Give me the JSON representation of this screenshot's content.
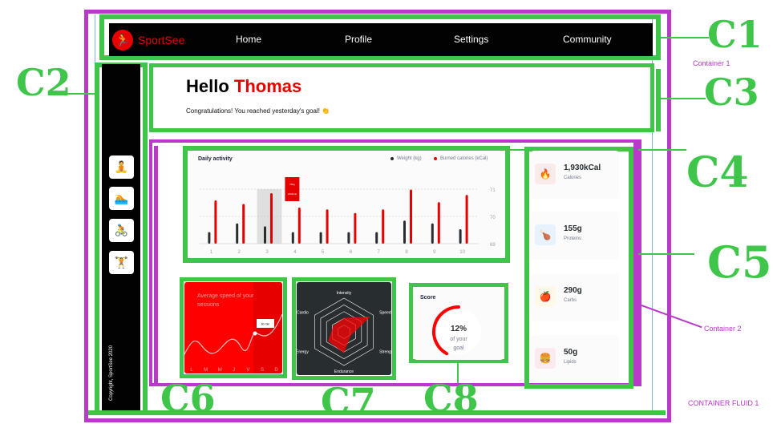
{
  "header": {
    "logo_text": "SportSee",
    "nav": [
      "Home",
      "Profile",
      "Settings",
      "Community"
    ]
  },
  "sidebar": {
    "icons": [
      "yoga-icon",
      "swim-icon",
      "bike-icon",
      "dumbbell-icon"
    ],
    "copyright": "Copyright, SportSee 2020"
  },
  "greeting": {
    "hello": "Hello",
    "name": "Thomas",
    "message": "Congratulations! You reached yesterday's goal! 👏"
  },
  "annotations": {
    "container_1": "Container 1",
    "container_2": "Container 2",
    "container_fluid": "CONTAINER FLUID 1",
    "c1": "C1",
    "c2": "C2",
    "c3": "C3",
    "c4": "C4",
    "c5": "C5",
    "c6": "C6",
    "c7": "C7",
    "c8": "C8"
  },
  "nutrition": [
    {
      "value": "1,930kCal",
      "label": "Calories",
      "icon": "flame-icon",
      "bg": "#fbeaea",
      "fg": "#ff0000"
    },
    {
      "value": "155g",
      "label": "Proteins",
      "icon": "chicken-icon",
      "bg": "#e8f2fc",
      "fg": "#4ab8ff"
    },
    {
      "value": "290g",
      "label": "Carbs",
      "icon": "apple-icon",
      "bg": "#fdf8e8",
      "fg": "#fdcc0c"
    },
    {
      "value": "50g",
      "label": "Lipids",
      "icon": "burger-icon",
      "bg": "#fbeaef",
      "fg": "#fd5181"
    }
  ],
  "colors": {
    "accent": "#e60000",
    "dark": "#020203",
    "annotation_green": "#3fc64a",
    "annotation_purple": "#b93ac9"
  },
  "chart_data": [
    {
      "type": "bar",
      "title": "Daily activity",
      "categories": [
        "1",
        "2",
        "3",
        "4",
        "5",
        "6",
        "7",
        "8",
        "9",
        "10"
      ],
      "series": [
        {
          "name": "Weight (kg)",
          "values": [
            69.7,
            70,
            69.9,
            69.7,
            69.7,
            69.7,
            69.7,
            70.1,
            70,
            69.8
          ],
          "color": "#282d30"
        },
        {
          "name": "Burned calories (kCal)",
          "values": [
            240,
            220,
            280,
            200,
            190,
            170,
            190,
            300,
            230,
            270
          ],
          "color": "#e60000"
        }
      ],
      "yticks": [
        69,
        70,
        71
      ],
      "ylim": [
        69,
        71
      ],
      "tooltip": {
        "category": "3",
        "lines": [
          "70kg",
          "240kCal"
        ]
      },
      "grid": true,
      "legend": "top-right"
    },
    {
      "type": "line",
      "title": "Average speed of your sessions",
      "categories": [
        "L",
        "M",
        "M",
        "J",
        "V",
        "S",
        "D"
      ],
      "values": [
        30,
        23,
        45,
        50,
        0,
        0,
        60
      ],
      "tooltip": {
        "category": "V",
        "label": "60 min"
      }
    },
    {
      "type": "radar",
      "categories": [
        "Intensity",
        "Speed",
        "Strength",
        "Endurance",
        "Energy",
        "Cardio"
      ],
      "values": [
        90,
        200,
        50,
        140,
        120,
        80
      ]
    },
    {
      "type": "pie",
      "title": "Score",
      "values": [
        12
      ],
      "center_value": "12%",
      "center_text": [
        "of your",
        "goal"
      ]
    }
  ]
}
